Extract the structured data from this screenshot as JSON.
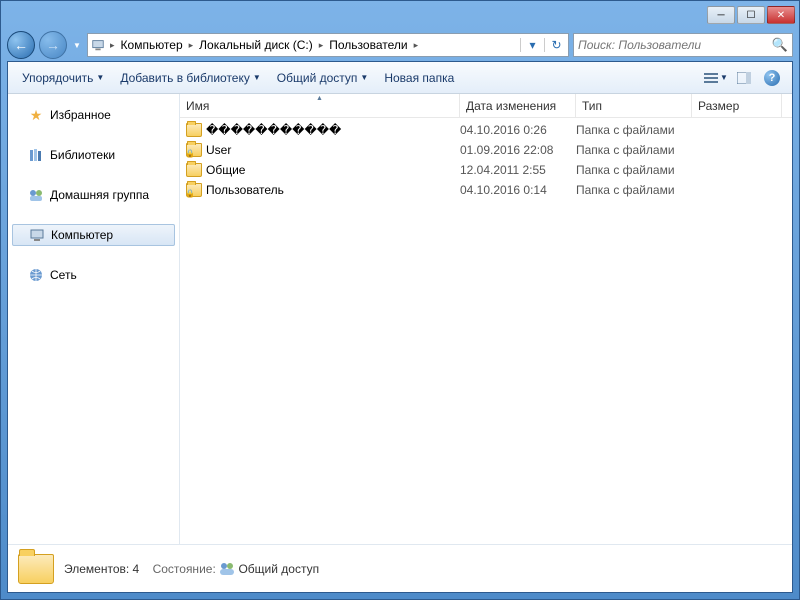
{
  "titlebar": {
    "minimize": "─",
    "maximize": "☐",
    "close": "✕"
  },
  "nav": {
    "back_icon": "←",
    "forward_icon": "→",
    "refresh_icon": "↻"
  },
  "breadcrumb": {
    "items": [
      "Компьютер",
      "Локальный диск (C:)",
      "Пользователи"
    ]
  },
  "search": {
    "placeholder": "Поиск: Пользователи"
  },
  "toolbar": {
    "organize": "Упорядочить",
    "add_to_library": "Добавить в библиотеку",
    "share": "Общий доступ",
    "new_folder": "Новая папка"
  },
  "sidebar": {
    "favorites": "Избранное",
    "libraries": "Библиотеки",
    "homegroup": "Домашняя группа",
    "computer": "Компьютер",
    "network": "Сеть"
  },
  "columns": {
    "name": "Имя",
    "date": "Дата изменения",
    "type": "Тип",
    "size": "Размер"
  },
  "files": [
    {
      "name": "�����������",
      "date": "04.10.2016 0:26",
      "type": "Папка с файлами",
      "locked": false
    },
    {
      "name": "User",
      "date": "01.09.2016 22:08",
      "type": "Папка с файлами",
      "locked": true
    },
    {
      "name": "Общие",
      "date": "12.04.2011 2:55",
      "type": "Папка с файлами",
      "locked": false
    },
    {
      "name": "Пользователь",
      "date": "04.10.2016 0:14",
      "type": "Папка с файлами",
      "locked": true
    }
  ],
  "statusbar": {
    "elements_label": "Элементов: 4",
    "state_label": "Состояние:",
    "state_value": "Общий доступ"
  }
}
